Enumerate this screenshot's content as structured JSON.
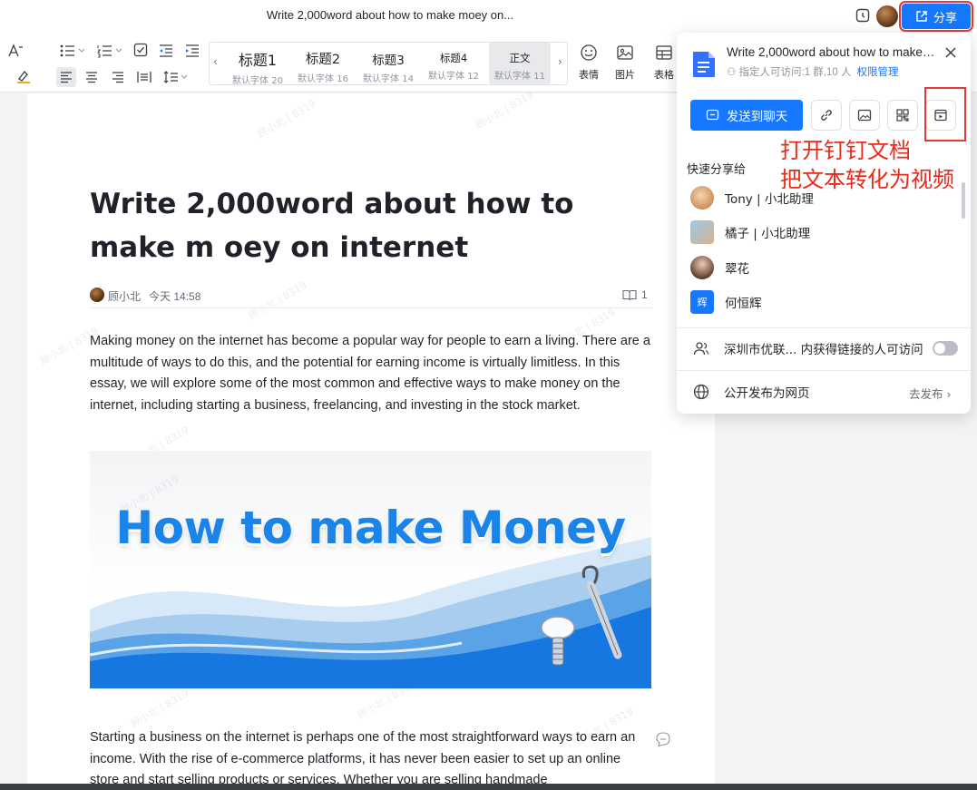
{
  "window": {
    "title": "Write 2,000word about how to make moey on...",
    "share_label": "分享"
  },
  "toolbar": {
    "styles": [
      {
        "name": "标题1",
        "sub": "默认字体 20"
      },
      {
        "name": "标题2",
        "sub": "默认字体 16"
      },
      {
        "name": "标题3",
        "sub": "默认字体 14"
      },
      {
        "name": "标题4",
        "sub": "默认字体 12"
      },
      {
        "name": "正文",
        "sub": "默认字体 11"
      }
    ],
    "insert": [
      {
        "label": "表情",
        "icon": "emoji-icon"
      },
      {
        "label": "图片",
        "icon": "image-icon"
      },
      {
        "label": "表格",
        "icon": "table-icon"
      }
    ]
  },
  "document": {
    "title": "Write 2,000word about how to make m oey on internet",
    "author": "顾小北",
    "time": "今天 14:58",
    "read_count": "1",
    "para1": "Making money on the internet has become a popular way for people to earn a living. There are a multitude of ways to do this, and the potential for earning income is virtually limitless. In this essay, we will explore some of the most common and effective ways to make money on the internet, including starting a business, freelancing, and investing in the stock market.",
    "image_title": "How to make Money",
    "para2": "Starting a business on the internet is perhaps one of the most straightforward ways to earn an income. With the rise of e-commerce platforms, it has never been easier to set up an online store and start selling products or services. Whether you are selling handmade",
    "watermark": "顾小北 | 8319"
  },
  "share_panel": {
    "doc_title": "Write 2,000word about how to make ...",
    "access_text": "指定人可访问:1 群,10 人",
    "permission_link": "权限管理",
    "send_label": "发送到聊天",
    "annotation_line1": "打开钉钉文档",
    "annotation_line2": "把文本转化为视频",
    "quick_share_label": "快速分享给",
    "contacts": [
      {
        "name": "Tony | 小北助理"
      },
      {
        "name": "橘子 | 小北助理"
      },
      {
        "name": "翠花"
      },
      {
        "name": "何恒辉",
        "badge": "辉"
      }
    ],
    "org_access_text": "深圳市优联... 内获得链接的人可访问",
    "publish_text": "公开发布为网页",
    "publish_action": "去发布 ›"
  },
  "colors": {
    "accent": "#1677ff",
    "annotation": "#e8291b",
    "hero_text": "#1a84e8"
  }
}
